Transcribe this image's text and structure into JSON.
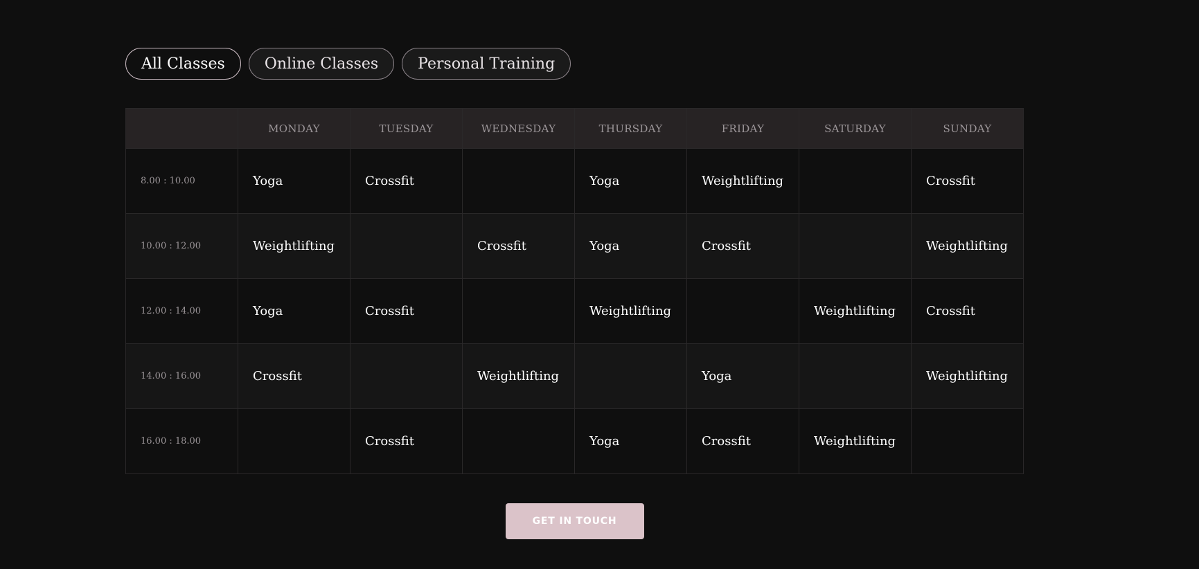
{
  "tabs": [
    {
      "label": "All Classes",
      "active": true
    },
    {
      "label": "Online Classes",
      "active": false
    },
    {
      "label": "Personal Training",
      "active": false
    }
  ],
  "schedule": {
    "corner": "",
    "days": [
      "MONDAY",
      "TUESDAY",
      "WEDNESDAY",
      "THURSDAY",
      "FRIDAY",
      "SATURDAY",
      "SUNDAY"
    ],
    "rows": [
      {
        "time": "8.00 : 10.00",
        "cells": [
          "Yoga",
          "Crossfit",
          "",
          "Yoga",
          "Weightlifting",
          "",
          "Crossfit"
        ]
      },
      {
        "time": "10.00 : 12.00",
        "cells": [
          "Weightlifting",
          "",
          "Crossfit",
          "Yoga",
          "Crossfit",
          "",
          "Weightlifting"
        ]
      },
      {
        "time": "12.00 : 14.00",
        "cells": [
          "Yoga",
          "Crossfit",
          "",
          "Weightlifting",
          "",
          "Weightlifting",
          "Crossfit"
        ]
      },
      {
        "time": "14.00 : 16.00",
        "cells": [
          "Crossfit",
          "",
          "Weightlifting",
          "",
          "Yoga",
          "",
          "Weightlifting"
        ]
      },
      {
        "time": "16.00 : 18.00",
        "cells": [
          "",
          "Crossfit",
          "",
          "Yoga",
          "Crossfit",
          "Weightlifting",
          ""
        ]
      }
    ]
  },
  "cta": {
    "label": "GET IN TOUCH"
  },
  "colors": {
    "background": "#0f0f0f",
    "header_bg": "#272324",
    "row_alt_bg": "#161616",
    "accent": "#dbc3c9"
  }
}
